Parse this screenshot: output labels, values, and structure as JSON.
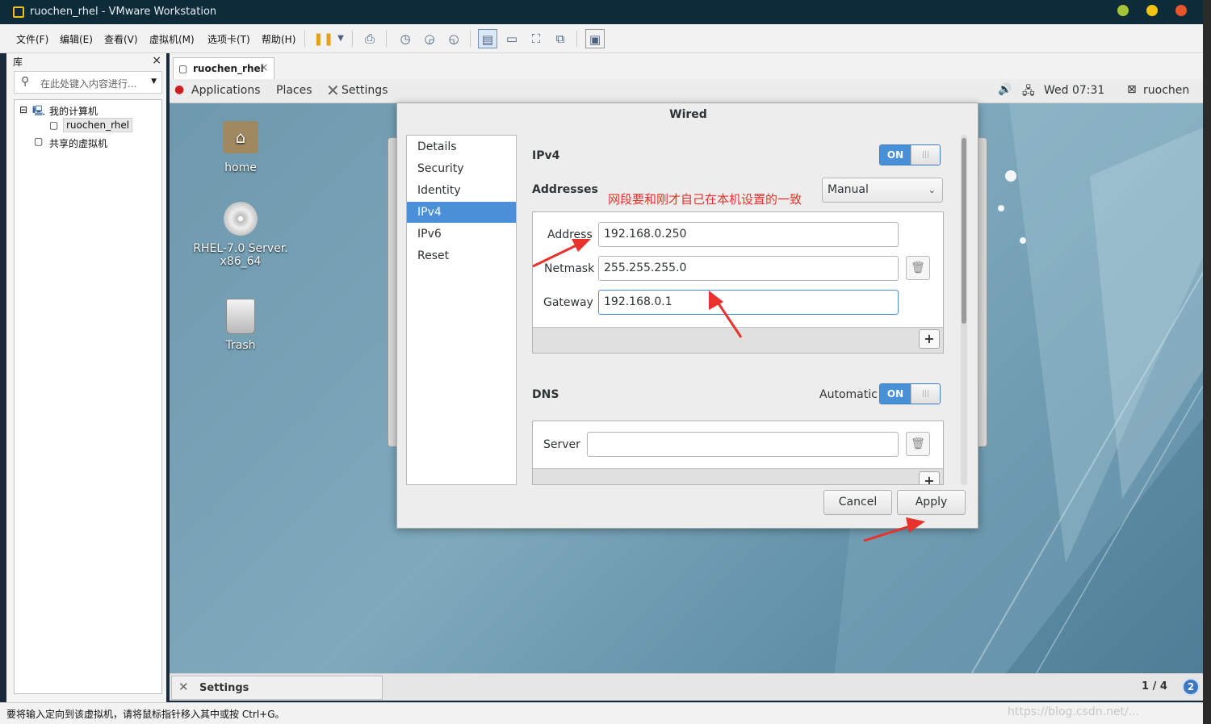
{
  "window": {
    "title": "ruochen_rhel - VMware Workstation",
    "dot_colors": [
      "#a6c33a",
      "#f1c40f",
      "#e8532a"
    ]
  },
  "menubar": {
    "items": [
      "文件(F)",
      "编辑(E)",
      "查看(V)",
      "虚拟机(M)",
      "选项卡(T)",
      "帮助(H)"
    ]
  },
  "library": {
    "title": "库",
    "close": "×",
    "search_placeholder": "在此处键入内容进行...",
    "tree": {
      "root": "我的计算机",
      "vm": "ruochen_rhel",
      "shared": "共享的虚拟机"
    }
  },
  "vm_tab": {
    "label": "ruochen_rhel",
    "close": "×"
  },
  "guest_topbar": {
    "applications": "Applications",
    "places": "Places",
    "settings": "Settings",
    "clock": "Wed 07:31",
    "user": "ruochen"
  },
  "desktop": {
    "home": "home",
    "disc_line1": "RHEL-7.0 Server.",
    "disc_line2": "x86_64",
    "trash": "Trash"
  },
  "dialog": {
    "title": "Wired",
    "nav": [
      "Details",
      "Security",
      "Identity",
      "IPv4",
      "IPv6",
      "Reset"
    ],
    "active_nav": "IPv4",
    "ipv4_label": "IPv4",
    "ipv4_switch": "ON",
    "addresses_label": "Addresses",
    "method": "Manual",
    "annotation": "网段要和刚才自己在本机设置的一致",
    "address_label": "Address",
    "address_value": "192.168.0.250",
    "netmask_label": "Netmask",
    "netmask_value": "255.255.255.0",
    "gateway_label": "Gateway",
    "gateway_value": "192.168.0.1",
    "dns_label": "DNS",
    "automatic_label": "Automatic",
    "dns_switch": "ON",
    "server_label": "Server",
    "server_value": "",
    "cancel": "Cancel",
    "apply": "Apply"
  },
  "guest_bottombar": {
    "taskbar_item": "Settings",
    "workspace": "1 / 4",
    "badge": "2"
  },
  "statusbar": {
    "text": "要将输入定向到该虚拟机，请将鼠标指针移入其中或按 Ctrl+G。",
    "watermark": "https://blog.csdn.net/..."
  },
  "colors": {
    "accent": "#4a90d9",
    "annotation": "#e8322b"
  }
}
